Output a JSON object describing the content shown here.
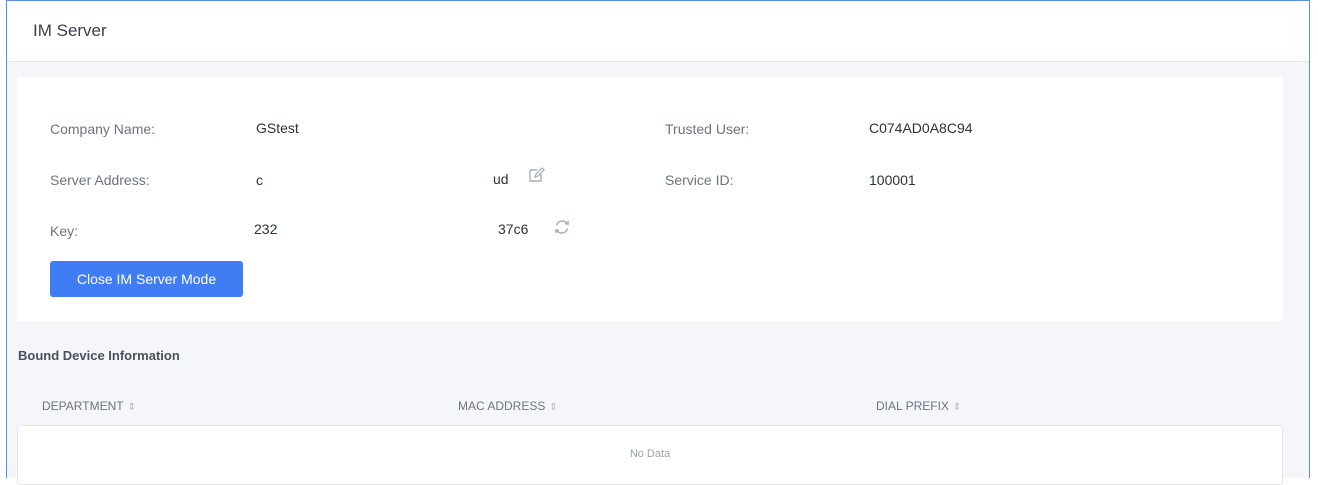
{
  "header": {
    "title": "IM Server"
  },
  "info": {
    "company_name_label": "Company Name:",
    "company_name_value": "GStest",
    "server_address_label": "Server Address:",
    "server_address_value_start": "c",
    "server_address_value_end": "ud",
    "key_label": "Key:",
    "key_value_start": "232",
    "key_value_end": "37c6",
    "trusted_user_label": "Trusted User:",
    "trusted_user_value": "C074AD0A8C94",
    "service_id_label": "Service ID:",
    "service_id_value": "100001",
    "close_button_label": "Close IM Server Mode"
  },
  "bound_devices": {
    "title": "Bound Device Information",
    "columns": [
      "DEPARTMENT",
      "MAC ADDRESS",
      "DIAL PREFIX"
    ],
    "empty_text": "No Data"
  },
  "colors": {
    "accent": "#3f7df4",
    "frame_border": "#5b8fe0"
  },
  "icons": {
    "edit": "edit-icon",
    "refresh": "refresh-icon",
    "sort": "sort-icon"
  }
}
